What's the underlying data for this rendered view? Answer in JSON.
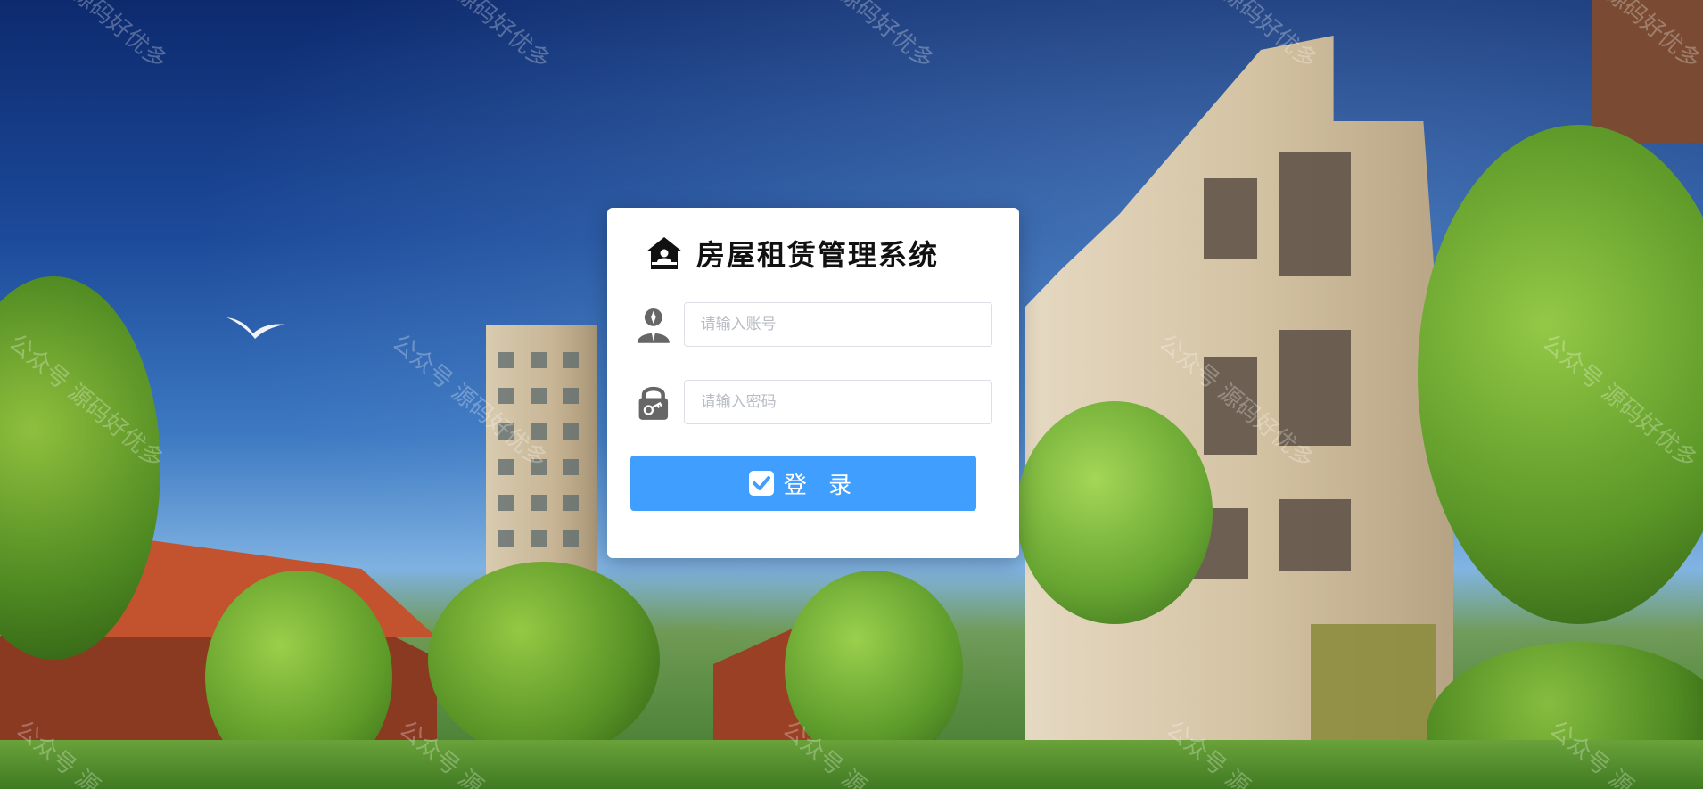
{
  "app": {
    "title": "房屋租赁管理系统",
    "logo_icon": "house-icon"
  },
  "login_form": {
    "username": {
      "placeholder": "请输入账号",
      "value": "",
      "icon": "user-avatar-icon"
    },
    "password": {
      "placeholder": "请输入密码",
      "value": "",
      "icon": "lock-key-icon"
    },
    "submit": {
      "label": "登 录",
      "icon": "checkbox-check-icon",
      "color": "#409eff"
    }
  },
  "watermark": {
    "text": "公众号 源码好优多",
    "fragment_top": "源码好优多",
    "fragment_bottom": "公众号 源"
  }
}
